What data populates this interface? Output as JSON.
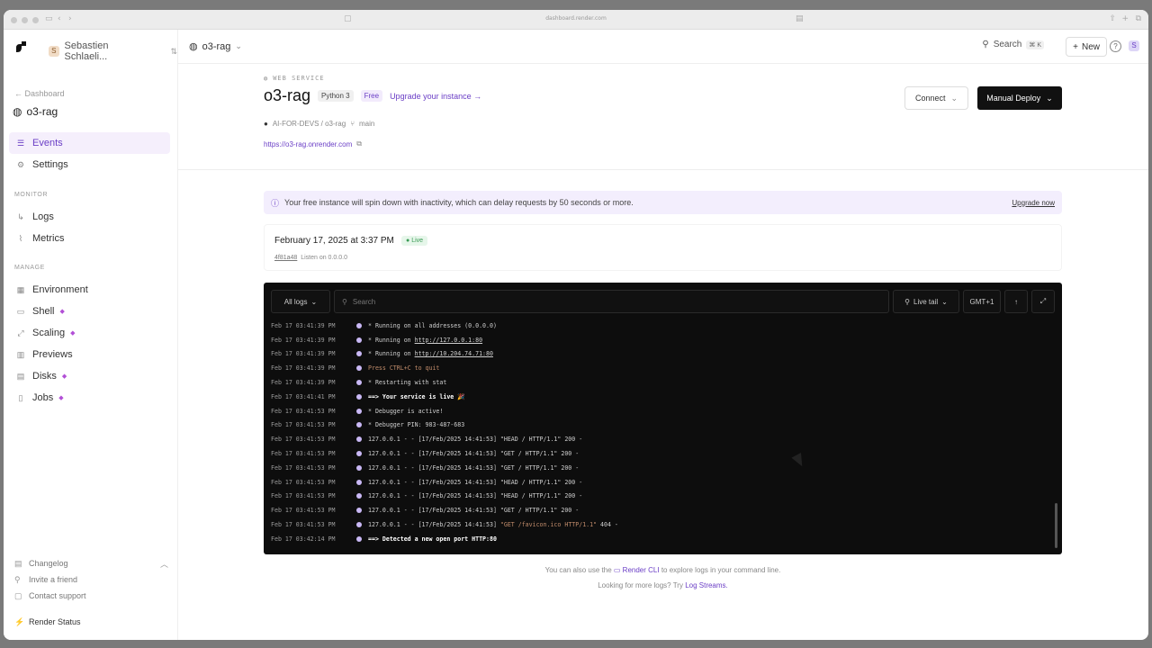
{
  "browser": {
    "url": "dashboard.render.com"
  },
  "sidebar": {
    "workspace": "Sebastien Schlaeli...",
    "workspace_initial": "S",
    "back_label": "Dashboard",
    "service": "o3-rag",
    "nav_primary": [
      {
        "label": "Events",
        "icon": "list-icon",
        "active": true
      },
      {
        "label": "Settings",
        "icon": "gear-icon"
      }
    ],
    "monitor_label": "MONITOR",
    "nav_monitor": [
      {
        "label": "Logs",
        "icon": "logs-icon"
      },
      {
        "label": "Metrics",
        "icon": "metrics-icon"
      }
    ],
    "manage_label": "MANAGE",
    "nav_manage": [
      {
        "label": "Environment",
        "icon": "environment-icon"
      },
      {
        "label": "Shell",
        "icon": "shell-icon",
        "dot": true
      },
      {
        "label": "Scaling",
        "icon": "scaling-icon",
        "dot": true
      },
      {
        "label": "Previews",
        "icon": "previews-icon"
      },
      {
        "label": "Disks",
        "icon": "disks-icon",
        "dot": true
      },
      {
        "label": "Jobs",
        "icon": "jobs-icon",
        "dot": true
      }
    ],
    "bottom": {
      "changelog": "Changelog",
      "invite": "Invite a friend",
      "support": "Contact support",
      "status": "Render Status"
    }
  },
  "topbar": {
    "project": "o3-rag",
    "search_label": "Search",
    "search_shortcut": "⌘ K",
    "new_label": "New",
    "help_icon": "?",
    "user_initial": "S"
  },
  "service": {
    "type": "WEB SERVICE",
    "name": "o3-rag",
    "runtime": "Python 3",
    "plan": "Free",
    "upgrade_link": "Upgrade your instance →",
    "repo": "AI-FOR-DEVS / o3-rag",
    "branch": "main",
    "url": "https://o3-rag.onrender.com",
    "connect_label": "Connect",
    "deploy_label": "Manual Deploy"
  },
  "notice": {
    "text": "Your free instance will spin down with inactivity, which can delay requests by 50 seconds or more.",
    "link": "Upgrade now"
  },
  "event": {
    "date": "February 17, 2025 at 3:37 PM",
    "status": "Live",
    "commit": "4f81a48",
    "message": "Listen on 0.0.0.0"
  },
  "logs": {
    "filter_label": "All logs",
    "search_placeholder": "Search",
    "live_label": "Live tail",
    "timezone": "GMT+1",
    "lines": [
      {
        "ts": "Feb 17 03:41:39 PM",
        "msg": " * Running on all addresses (0.0.0.0)",
        "kind": ""
      },
      {
        "ts": "Feb 17 03:41:39 PM",
        "pre": " * Running on ",
        "url": "http://127.0.0.1:80",
        "kind": "link"
      },
      {
        "ts": "Feb 17 03:41:39 PM",
        "pre": " * Running on ",
        "url": "http://10.204.74.71:80",
        "kind": "link"
      },
      {
        "ts": "Feb 17 03:41:39 PM",
        "msg": "Press CTRL+C to quit",
        "kind": "warn"
      },
      {
        "ts": "Feb 17 03:41:39 PM",
        "msg": " * Restarting with stat",
        "kind": ""
      },
      {
        "ts": "Feb 17 03:41:41 PM",
        "msg": "==> Your service is live 🎉",
        "kind": "bold"
      },
      {
        "ts": "Feb 17 03:41:53 PM",
        "msg": " * Debugger is active!",
        "kind": ""
      },
      {
        "ts": "Feb 17 03:41:53 PM",
        "msg": " * Debugger PIN: 983-487-683",
        "kind": ""
      },
      {
        "ts": "Feb 17 03:41:53 PM",
        "msg": "127.0.0.1 - - [17/Feb/2025 14:41:53] \"HEAD / HTTP/1.1\" 200 -",
        "kind": ""
      },
      {
        "ts": "Feb 17 03:41:53 PM",
        "msg": "127.0.0.1 - - [17/Feb/2025 14:41:53] \"GET / HTTP/1.1\" 200 -",
        "kind": ""
      },
      {
        "ts": "Feb 17 03:41:53 PM",
        "msg": "127.0.0.1 - - [17/Feb/2025 14:41:53] \"GET / HTTP/1.1\" 200 -",
        "kind": ""
      },
      {
        "ts": "Feb 17 03:41:53 PM",
        "msg": "127.0.0.1 - - [17/Feb/2025 14:41:53] \"HEAD / HTTP/1.1\" 200 -",
        "kind": ""
      },
      {
        "ts": "Feb 17 03:41:53 PM",
        "msg": "127.0.0.1 - - [17/Feb/2025 14:41:53] \"HEAD / HTTP/1.1\" 200 -",
        "kind": ""
      },
      {
        "ts": "Feb 17 03:41:53 PM",
        "msg": "127.0.0.1 - - [17/Feb/2025 14:41:53] \"GET / HTTP/1.1\" 200 -",
        "kind": ""
      },
      {
        "ts": "Feb 17 03:41:53 PM",
        "pre": "127.0.0.1 - - [17/Feb/2025 14:41:53] ",
        "req": "\"GET /favicon.ico HTTP/1.1\"",
        "post": " 404 -",
        "kind": "notfound"
      },
      {
        "ts": "Feb 17 03:42:14 PM",
        "msg": "==> Detected a new open port HTTP:80",
        "kind": "bold"
      }
    ]
  },
  "footer": {
    "cli_pre": "You can also use the",
    "cli_link": "Render CLI",
    "cli_post": "to explore logs in your command line.",
    "streams_pre": "Looking for more logs? Try",
    "streams_link": "Log Streams."
  }
}
